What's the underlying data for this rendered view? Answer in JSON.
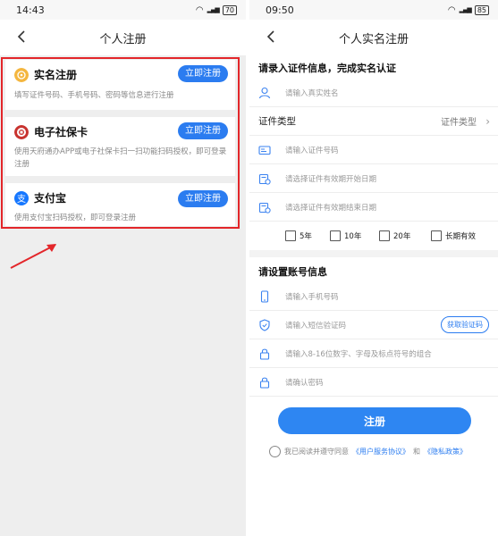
{
  "left": {
    "status": {
      "time": "14:43",
      "battery": "70"
    },
    "nav": {
      "title": "个人注册"
    },
    "options": [
      {
        "name": "实名注册",
        "button": "立即注册",
        "desc": "填写证件号码、手机号码、密码等信息进行注册",
        "icon": "smiley-icon"
      },
      {
        "name": "电子社保卡",
        "button": "立即注册",
        "desc": "使用天府通办APP或电子社保卡扫一扫功能扫码授权，即可登录注册",
        "icon": "social-security-card-icon"
      },
      {
        "name": "支付宝",
        "button": "立即注册",
        "desc": "使用支付宝扫码授权，即可登录注册",
        "icon": "alipay-icon"
      }
    ]
  },
  "right": {
    "status": {
      "time": "09:50",
      "battery": "85"
    },
    "nav": {
      "title": "个人实名注册"
    },
    "identity_section": {
      "title": "请录入证件信息，完成实名认证",
      "name_placeholder": "请输入真实姓名",
      "id_type_label": "证件类型",
      "id_type_value": "证件类型",
      "id_number_placeholder": "请输入证件号码",
      "valid_start_placeholder": "请选择证件有效期开始日期",
      "valid_end_placeholder": "请选择证件有效期结束日期",
      "validity_options": [
        "5年",
        "10年",
        "20年",
        "长期有效"
      ]
    },
    "account_section": {
      "title": "请设置账号信息",
      "phone_placeholder": "请输入手机号码",
      "sms_placeholder": "请输入短信验证码",
      "sms_button": "获取验证码",
      "password_placeholder": "请输入8-16位数字、字母及标点符号的组合",
      "confirm_placeholder": "请确认密码"
    },
    "submit_label": "注册",
    "agreement": {
      "prefix": "我已阅读并遵守同意",
      "user_agreement": "《用户服务协议》",
      "and": "和",
      "privacy": "《隐私政策》"
    }
  },
  "colors": {
    "primary": "#2b7cf0",
    "highlight": "#e3262a"
  }
}
